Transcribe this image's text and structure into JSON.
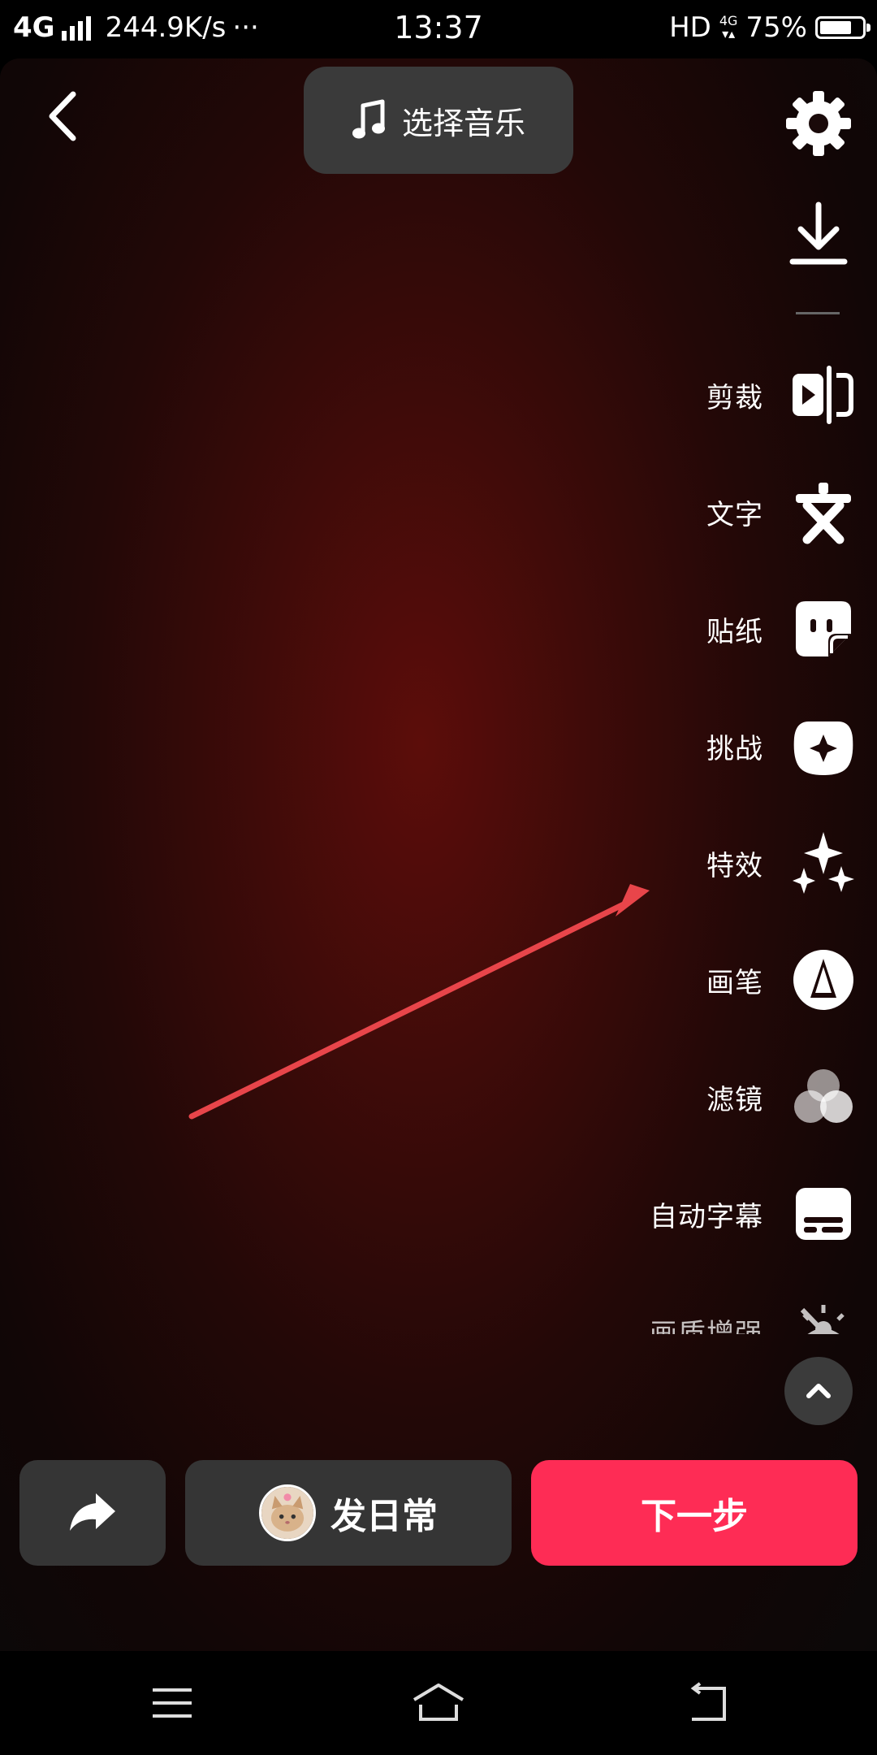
{
  "status_bar": {
    "network": "4G",
    "speed": "244.9K/s",
    "more": "···",
    "time": "13:37",
    "hd": "HD",
    "sub_network": "4G",
    "battery": "75%",
    "battery_level": 0.75
  },
  "top": {
    "music_label": "选择音乐"
  },
  "tools": [
    {
      "label": "剪裁",
      "icon": "clip-icon"
    },
    {
      "label": "文字",
      "icon": "text-icon"
    },
    {
      "label": "贴纸",
      "icon": "sticker-icon"
    },
    {
      "label": "挑战",
      "icon": "challenge-icon"
    },
    {
      "label": "特效",
      "icon": "effects-icon"
    },
    {
      "label": "画笔",
      "icon": "brush-icon"
    },
    {
      "label": "滤镜",
      "icon": "filter-icon"
    },
    {
      "label": "自动字幕",
      "icon": "captions-icon"
    },
    {
      "label": "画质增强",
      "icon": "enhance-icon"
    }
  ],
  "bottom": {
    "daily_label": "发日常",
    "next_label": "下一步"
  },
  "colors": {
    "accent": "#fe2c55",
    "annotation_arrow": "#e8454a"
  }
}
